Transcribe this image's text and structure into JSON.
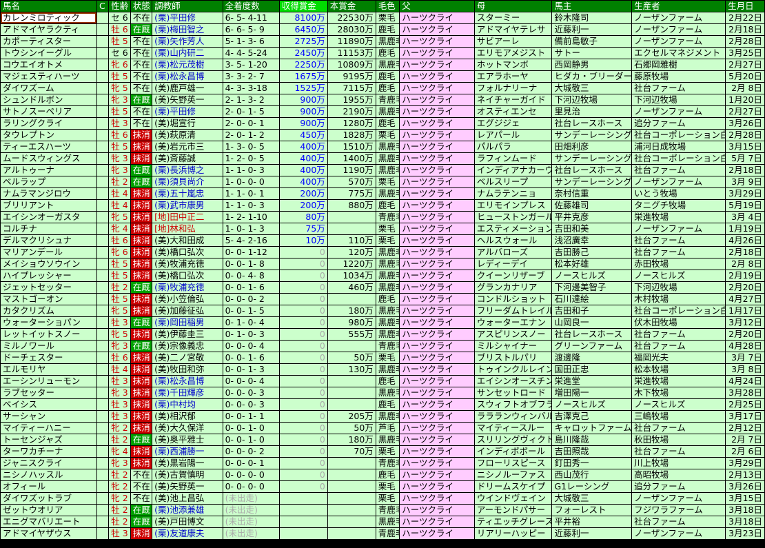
{
  "headers": {
    "name": "馬名",
    "c": "C",
    "sexage": "性齢",
    "status": "状態",
    "trainer": "調教師",
    "record": "全着度数",
    "earnings": "収得賞金",
    "prize": "本賞金",
    "color": "毛色",
    "sire": "父",
    "dam": "母",
    "owner": "馬主",
    "breeder": "生産者",
    "birthday": "生月日"
  },
  "rows": [
    {
      "name": "カレンミロティック",
      "c": "",
      "sex": "セ",
      "age": "6",
      "status": "不在",
      "trainer": "(栗)平田修",
      "record": "6- 5- 4-11",
      "earnings": "8100万",
      "prize": "22530万",
      "color": "栗毛",
      "sire": "ハーツクライ",
      "dam": "スターミー",
      "owner": "鈴木隆司",
      "breeder": "ノーザンファーム",
      "birthday": "2月22日"
    },
    {
      "name": "アドマイヤラクティ",
      "c": "",
      "sex": "牡",
      "age": "6",
      "status": "在厩",
      "trainer": "(栗)梅田智之",
      "record": "6- 6- 5- 9",
      "earnings": "6450万",
      "prize": "28030万",
      "color": "鹿毛",
      "sire": "ハーツクライ",
      "dam": "アドマイヤテレサ",
      "owner": "近藤利一",
      "breeder": "ノーザンファーム",
      "birthday": "2月18日"
    },
    {
      "name": "カポーティスター",
      "c": "",
      "sex": "牡",
      "age": "5",
      "status": "不在",
      "trainer": "(栗)矢作芳人",
      "record": "5- 1- 3- 6",
      "earnings": "2725万",
      "prize": "11890万",
      "color": "黒鹿毛",
      "sire": "ハーツクライ",
      "dam": "サビアーレ",
      "owner": "備前島敏子",
      "breeder": "ノーザンファーム",
      "birthday": "2月28日"
    },
    {
      "name": "トウシンイーグル",
      "c": "",
      "sex": "セ",
      "age": "6",
      "status": "不在",
      "trainer": "(栗)山内研二",
      "record": "4- 4- 5-24",
      "earnings": "2450万",
      "prize": "11153万",
      "color": "鹿毛",
      "sire": "ハーツクライ",
      "dam": "エリモアメジスト",
      "owner": "サトー",
      "breeder": "エクセルマネジメント",
      "birthday": "3月25日"
    },
    {
      "name": "コウエイオトメ",
      "c": "",
      "sex": "牝",
      "age": "6",
      "status": "不在",
      "trainer": "(栗)松元茂樹",
      "record": "3- 5- 1-20",
      "earnings": "2250万",
      "prize": "10809万",
      "color": "黒鹿毛",
      "sire": "ハーツクライ",
      "dam": "ホットマンボ",
      "owner": "西岡静男",
      "breeder": "石郷岡雅樹",
      "birthday": "2月27日"
    },
    {
      "name": "マジェスティハーツ",
      "c": "",
      "sex": "牡",
      "age": "5",
      "status": "不在",
      "trainer": "(栗)松永昌博",
      "record": "3- 3- 2- 7",
      "earnings": "1675万",
      "prize": "9195万",
      "color": "鹿毛",
      "sire": "ハーツクライ",
      "dam": "エアラホーヤ",
      "owner": "ヒダカ・ブリーダーズ・ユニ",
      "breeder": "藤原牧場",
      "birthday": "5月20日"
    },
    {
      "name": "ダイワズーム",
      "c": "",
      "sex": "牝",
      "age": "5",
      "status": "不在",
      "trainer": "(美)鹿戸雄一",
      "record": "4- 3- 3-18",
      "earnings": "1525万",
      "prize": "7115万",
      "color": "鹿毛",
      "sire": "ハーツクライ",
      "dam": "フォルナリーナ",
      "owner": "大城敬三",
      "breeder": "社台ファーム",
      "birthday": "2月 8日"
    },
    {
      "name": "シュンドルボン",
      "c": "",
      "sex": "牝",
      "age": "3",
      "status": "在厩",
      "trainer": "(美)矢野英一",
      "record": "2- 1- 3- 2",
      "earnings": "900万",
      "prize": "1955万",
      "color": "青鹿毛",
      "sire": "ハーツクライ",
      "dam": "ネイチャーガイド",
      "owner": "下河辺牧場",
      "breeder": "下河辺牧場",
      "birthday": "1月20日"
    },
    {
      "name": "サトノスーペリア",
      "c": "",
      "sex": "牡",
      "age": "5",
      "status": "不在",
      "trainer": "(栗)平田修",
      "record": "2- 0- 1- 5",
      "earnings": "900万",
      "prize": "2190万",
      "color": "黒鹿毛",
      "sire": "ハーツクライ",
      "dam": "オスティエンセ",
      "owner": "里見治",
      "breeder": "ノーザンファーム",
      "birthday": "2月27日"
    },
    {
      "name": "ラリングクライ",
      "c": "",
      "sex": "牡",
      "age": "3",
      "status": "不在",
      "trainer": "(美)堀宣行",
      "record": "2- 0- 0- 1",
      "earnings": "900万",
      "prize": "1280万",
      "color": "鹿毛",
      "sire": "ハーツクライ",
      "dam": "エグジジェ",
      "owner": "社台レースホース",
      "breeder": "追分ファーム",
      "birthday": "3月26日"
    },
    {
      "name": "タウレプトン",
      "c": "",
      "sex": "牡",
      "age": "6",
      "status": "抹消",
      "trainer": "(美)萩原清",
      "record": "2- 0- 1- 2",
      "earnings": "450万",
      "prize": "1828万",
      "color": "栗毛",
      "sire": "ハーツクライ",
      "dam": "レアパール",
      "owner": "サンデーレーシング",
      "breeder": "社台コーポレーション白老",
      "birthday": "2月28日"
    },
    {
      "name": "ティーエスハーツ",
      "c": "",
      "sex": "牡",
      "age": "5",
      "status": "抹消",
      "trainer": "(美)岩元市三",
      "record": "1- 3- 0- 5",
      "earnings": "400万",
      "prize": "1510万",
      "color": "黒鹿毛",
      "sire": "ハーツクライ",
      "dam": "パルパラ",
      "owner": "田畑利彦",
      "breeder": "浦河日成牧場",
      "birthday": "3月15日"
    },
    {
      "name": "ムードスウィングス",
      "c": "",
      "sex": "牝",
      "age": "3",
      "status": "抹消",
      "trainer": "(美)斎藤誠",
      "record": "1- 2- 0- 5",
      "earnings": "400万",
      "prize": "1400万",
      "color": "黒鹿毛",
      "sire": "ハーツクライ",
      "dam": "ラフィンムード",
      "owner": "サンデーレーシング",
      "breeder": "社台コーポレーション白老",
      "birthday": "5月 7日"
    },
    {
      "name": "アルトゥーナ",
      "c": "",
      "sex": "牝",
      "age": "3",
      "status": "在厩",
      "trainer": "(栗)長浜博之",
      "record": "1- 1- 0- 3",
      "earnings": "400万",
      "prize": "1190万",
      "color": "黒鹿毛",
      "sire": "ハーツクライ",
      "dam": "インディアナカーヴ",
      "owner": "社台レースホース",
      "breeder": "社台ファーム",
      "birthday": "2月18日"
    },
    {
      "name": "ベルラップ",
      "c": "",
      "sex": "牡",
      "age": "2",
      "status": "在厩",
      "trainer": "(栗)須貝尚介",
      "record": "1- 0- 0- 0",
      "earnings": "400万",
      "prize": "570万",
      "color": "栗毛",
      "sire": "ハーツクライ",
      "dam": "ベルスリープ",
      "owner": "サンデーレーシング",
      "breeder": "ノーザンファーム",
      "birthday": "3月 9日"
    },
    {
      "name": "ナムラマンジロウ",
      "c": "",
      "sex": "牡",
      "age": "4",
      "status": "抹消",
      "trainer": "(栗)五十嵐忠",
      "record": "1- 1- 0- 1",
      "earnings": "200万",
      "prize": "775万",
      "color": "黒鹿毛",
      "sire": "ハーツクライ",
      "dam": "ナムラテンニョ",
      "owner": "奈村信重",
      "breeder": "いとう牧場",
      "birthday": "3月29日"
    },
    {
      "name": "ブリリアント",
      "c": "",
      "sex": "牡",
      "age": "4",
      "status": "抹消",
      "trainer": "(栗)武市康男",
      "record": "1- 1- 0- 3",
      "earnings": "200万",
      "prize": "880万",
      "color": "鹿毛",
      "sire": "ハーツクライ",
      "dam": "エリモインプレス",
      "owner": "佐藤雄司",
      "breeder": "タニグチ牧場",
      "birthday": "5月19日"
    },
    {
      "name": "エイシンオーガスタ",
      "c": "",
      "sex": "牝",
      "age": "5",
      "status": "抹消",
      "trainer": "[地]田中正二",
      "record": "1- 2- 1-10",
      "earnings": "80万",
      "prize": "",
      "color": "青鹿毛",
      "sire": "ハーツクライ",
      "dam": "ヒューストンガール",
      "owner": "平井克彦",
      "breeder": "栄進牧場",
      "birthday": "3月 4日"
    },
    {
      "name": "コルチナ",
      "c": "",
      "sex": "牝",
      "age": "4",
      "status": "抹消",
      "trainer": "[地]林和弘",
      "record": "1- 0- 1- 3",
      "earnings": "75万",
      "prize": "",
      "color": "栗毛",
      "sire": "ハーツクライ",
      "dam": "エスティメーション",
      "owner": "吉田和美",
      "breeder": "ノーザンファーム",
      "birthday": "1月19日"
    },
    {
      "name": "デルマクリシュナ",
      "c": "",
      "sex": "牡",
      "age": "6",
      "status": "抹消",
      "trainer": "(美)大和田成",
      "record": "5- 4- 2-16",
      "earnings": "10万",
      "prize": "110万",
      "color": "栗毛",
      "sire": "ハーツクライ",
      "dam": "ヘルスウォール",
      "owner": "浅沼廣幸",
      "breeder": "社台ファーム",
      "birthday": "4月26日"
    },
    {
      "name": "マリアンデール",
      "c": "",
      "sex": "牝",
      "age": "6",
      "status": "抹消",
      "trainer": "(美)橋口弘次",
      "record": "0- 0- 1-12",
      "earnings": "0",
      "prize": "120万",
      "color": "黒鹿毛",
      "sire": "ハーツクライ",
      "dam": "アルバローズ",
      "owner": "吉田勝己",
      "breeder": "社台ファーム",
      "birthday": "2月18日"
    },
    {
      "name": "メイショウソウイン",
      "c": "",
      "sex": "牡",
      "age": "5",
      "status": "抹消",
      "trainer": "(美)牧浦充徳",
      "record": "0- 0- 1- 8",
      "earnings": "0",
      "prize": "1220万",
      "color": "黒鹿毛",
      "sire": "ハーツクライ",
      "dam": "レディーデイ",
      "owner": "松本好雄",
      "breeder": "赤田牧場",
      "birthday": "2月 8日"
    },
    {
      "name": "ハイプレッシャー",
      "c": "",
      "sex": "牡",
      "age": "5",
      "status": "抹消",
      "trainer": "(美)橋口弘次",
      "record": "0- 0- 4- 8",
      "earnings": "0",
      "prize": "1034万",
      "color": "黒鹿毛",
      "sire": "ハーツクライ",
      "dam": "クイーンリザーブ",
      "owner": "ノースヒルズ",
      "breeder": "ノースヒルズ",
      "birthday": "2月19日"
    },
    {
      "name": "ジェットセッター",
      "c": "",
      "sex": "牡",
      "age": "2",
      "status": "在厩",
      "trainer": "(栗)牧浦充徳",
      "record": "0- 0- 1- 6",
      "earnings": "0",
      "prize": "460万",
      "color": "黒鹿毛",
      "sire": "ハーツクライ",
      "dam": "グランカナリア",
      "owner": "下河邊美智子",
      "breeder": "下河辺牧場",
      "birthday": "2月20日"
    },
    {
      "name": "マストゴーオン",
      "c": "",
      "sex": "牡",
      "age": "5",
      "status": "抹消",
      "trainer": "(美)小笠倫弘",
      "record": "0- 0- 0- 2",
      "earnings": "0",
      "prize": "",
      "color": "鹿毛",
      "sire": "ハーツクライ",
      "dam": "コンドルショット",
      "owner": "石川達絵",
      "breeder": "木村牧場",
      "birthday": "4月27日"
    },
    {
      "name": "カタクリズム",
      "c": "",
      "sex": "牝",
      "age": "5",
      "status": "抹消",
      "trainer": "(美)加藤征弘",
      "record": "0- 0- 1- 5",
      "earnings": "0",
      "prize": "180万",
      "color": "黒鹿毛",
      "sire": "ハーツクライ",
      "dam": "フリーダムトレイル",
      "owner": "吉田和子",
      "breeder": "社台コーポレーション白老",
      "birthday": "1月17日"
    },
    {
      "name": "ウォーターショパン",
      "c": "",
      "sex": "牡",
      "age": "3",
      "status": "在厩",
      "trainer": "(栗)岡田稲男",
      "record": "0- 1- 0- 4",
      "earnings": "0",
      "prize": "980万",
      "color": "黒鹿毛",
      "sire": "ハーツクライ",
      "dam": "ウォーターエナン",
      "owner": "山岡良一",
      "breeder": "伏木田牧場",
      "birthday": "3月12日"
    },
    {
      "name": "レットイットスノー",
      "c": "",
      "sex": "牝",
      "age": "5",
      "status": "抹消",
      "trainer": "(美)伊藤圭三",
      "record": "0- 1- 0- 3",
      "earnings": "0",
      "prize": "555万",
      "color": "黒鹿毛",
      "sire": "ハーツクライ",
      "dam": "アスピリンスノー",
      "owner": "社台レースホース",
      "breeder": "社台ファーム",
      "birthday": "2月20日"
    },
    {
      "name": "ミルノワール",
      "c": "",
      "sex": "牝",
      "age": "3",
      "status": "在厩",
      "trainer": "(美)宗像義忠",
      "record": "0- 0- 0- 4",
      "earnings": "0",
      "prize": "",
      "color": "青鹿毛",
      "sire": "ハーツクライ",
      "dam": "ミルシャイナー",
      "owner": "グリーンファーム",
      "breeder": "社台ファーム",
      "birthday": "4月28日"
    },
    {
      "name": "ドーチェスター",
      "c": "",
      "sex": "牡",
      "age": "6",
      "status": "抹消",
      "trainer": "(美)二ノ宮敬",
      "record": "0- 0- 1- 6",
      "earnings": "0",
      "prize": "50万",
      "color": "栗毛",
      "sire": "ハーツクライ",
      "dam": "ブリストルパリ",
      "owner": "渡邊隆",
      "breeder": "福岡光夫",
      "birthday": "3月 7日"
    },
    {
      "name": "エルモリヤ",
      "c": "",
      "sex": "牡",
      "age": "4",
      "status": "抹消",
      "trainer": "(美)牧田和弥",
      "record": "0- 0- 1- 3",
      "earnings": "0",
      "prize": "130万",
      "color": "黒鹿毛",
      "sire": "ハーツクライ",
      "dam": "トゥインクルレイン",
      "owner": "国田正忠",
      "breeder": "松本牧場",
      "birthday": "3月 8日"
    },
    {
      "name": "エーシンリューモン",
      "c": "",
      "sex": "牡",
      "age": "3",
      "status": "抹消",
      "trainer": "(栗)松永昌博",
      "record": "0- 0- 0- 4",
      "earnings": "0",
      "prize": "",
      "color": "鹿毛",
      "sire": "ハーツクライ",
      "dam": "エイシンオースチン",
      "owner": "栄進堂",
      "breeder": "栄進牧場",
      "birthday": "4月24日"
    },
    {
      "name": "ラブセッター",
      "c": "",
      "sex": "牝",
      "age": "3",
      "status": "抹消",
      "trainer": "(栗)千田輝彦",
      "record": "0- 0- 0- 3",
      "earnings": "0",
      "prize": "",
      "color": "黒鹿毛",
      "sire": "ハーツクライ",
      "dam": "サンセットロード",
      "owner": "増田陽一",
      "breeder": "木下牧場",
      "birthday": "3月28日"
    },
    {
      "name": "ベイシス",
      "c": "",
      "sex": "牡",
      "age": "3",
      "status": "抹消",
      "trainer": "(栗)中村均",
      "record": "0- 0- 0- 3",
      "earnings": "0",
      "prize": "",
      "color": "鹿毛",
      "sire": "ハーツクライ",
      "dam": "スウィフトオブフライト",
      "owner": "ノースヒルズ",
      "breeder": "ノースヒルズ",
      "birthday": "2月25日"
    },
    {
      "name": "サーシャン",
      "c": "",
      "sex": "牡",
      "age": "3",
      "status": "抹消",
      "trainer": "(美)相沢郁",
      "record": "0- 0- 1- 1",
      "earnings": "0",
      "prize": "205万",
      "color": "黒鹿毛",
      "sire": "ハーツクライ",
      "dam": "ララランウィンバル",
      "owner": "吉澤克己",
      "breeder": "三嶋牧場",
      "birthday": "3月17日"
    },
    {
      "name": "マイティーハニー",
      "c": "",
      "sex": "牝",
      "age": "2",
      "status": "抹消",
      "trainer": "(美)大久保洋",
      "record": "0- 0- 1- 0",
      "earnings": "0",
      "prize": "50万",
      "color": "芦毛",
      "sire": "ハーツクライ",
      "dam": "マイティースルー",
      "owner": "キャロットファーム",
      "breeder": "社台ファーム",
      "birthday": "2月12日"
    },
    {
      "name": "トーセンジャズ",
      "c": "",
      "sex": "牡",
      "age": "2",
      "status": "在厩",
      "trainer": "(美)奥平雅士",
      "record": "0- 0- 1- 0",
      "earnings": "0",
      "prize": "180万",
      "color": "黒鹿毛",
      "sire": "ハーツクライ",
      "dam": "スリリングヴィクトリー",
      "owner": "島川隆哉",
      "breeder": "秋田牧場",
      "birthday": "2月 7日"
    },
    {
      "name": "ターワカチーナ",
      "c": "",
      "sex": "牝",
      "age": "4",
      "status": "抹消",
      "trainer": "(栗)西浦勝一",
      "record": "0- 0- 0- 2",
      "earnings": "0",
      "prize": "70万",
      "color": "栗毛",
      "sire": "ハーツクライ",
      "dam": "インディボボール",
      "owner": "吉田照哉",
      "breeder": "社台ファーム",
      "birthday": "2月 6日"
    },
    {
      "name": "ジャニスクライ",
      "c": "",
      "sex": "牝",
      "age": "3",
      "status": "抹消",
      "trainer": "(美)黒岩陽一",
      "record": "0- 0- 0- 1",
      "earnings": "0",
      "prize": "",
      "color": "青鹿毛",
      "sire": "ハーツクライ",
      "dam": "フローリスピース",
      "owner": "釘田秀一",
      "breeder": "川上牧場",
      "birthday": "3月29日"
    },
    {
      "name": "ニシノハッスル",
      "c": "",
      "sex": "牡",
      "age": "2",
      "status": "不在",
      "trainer": "(美)古賀慎明",
      "record": "0- 0- 0- 0",
      "earnings": "0",
      "prize": "",
      "color": "鹿毛",
      "sire": "ハーツクライ",
      "dam": "ニシノルーファス",
      "owner": "西山茂行",
      "breeder": "高昭牧場",
      "birthday": "2月13日"
    },
    {
      "name": "オフィール",
      "c": "",
      "sex": "牝",
      "age": "2",
      "status": "不在",
      "trainer": "(美)矢野英一",
      "record": "0- 0- 0- 0",
      "earnings": "0",
      "prize": "",
      "color": "栗毛",
      "sire": "ハーツクライ",
      "dam": "ドリームスケイプ",
      "owner": "G1レーシング",
      "breeder": "追分ファーム",
      "birthday": "3月26日"
    },
    {
      "name": "ダイワズットラブ",
      "c": "",
      "sex": "牝",
      "age": "2",
      "status": "不在",
      "trainer": "(美)池上昌弘",
      "record": "(未出走)",
      "earnings": "",
      "prize": "",
      "color": "栗毛",
      "sire": "ハーツクライ",
      "dam": "ウインドヴェイン",
      "owner": "大城敬三",
      "breeder": "ノーザンファーム",
      "birthday": "3月15日"
    },
    {
      "name": "ゼットウオリア",
      "c": "",
      "sex": "牡",
      "age": "2",
      "status": "在厩",
      "trainer": "(栗)池添兼雄",
      "record": "(未出走)",
      "earnings": "",
      "prize": "",
      "color": "青鹿毛",
      "sire": "ハーツクライ",
      "dam": "アーモンドパサー",
      "owner": "フォーレスト",
      "breeder": "フジワラファーム",
      "birthday": "3月18日"
    },
    {
      "name": "エニグマバリエート",
      "c": "",
      "sex": "牡",
      "age": "2",
      "status": "在厩",
      "trainer": "(美)戸田博文",
      "record": "(未出走)",
      "earnings": "",
      "prize": "",
      "color": "黒鹿毛",
      "sire": "ハーツクライ",
      "dam": "ティエッチグレース",
      "owner": "平井裕",
      "breeder": "社台ファーム",
      "birthday": "3月18日"
    },
    {
      "name": "アドマイヤザウス",
      "c": "",
      "sex": "牡",
      "age": "3",
      "status": "抹消",
      "trainer": "(栗)友道康夫",
      "record": "(未出走)",
      "earnings": "",
      "prize": "",
      "color": "青鹿毛",
      "sire": "ハーツクライ",
      "dam": "リアリーハッピー",
      "owner": "近藤利一",
      "breeder": "ノーザンファーム",
      "birthday": "3月23日"
    }
  ]
}
